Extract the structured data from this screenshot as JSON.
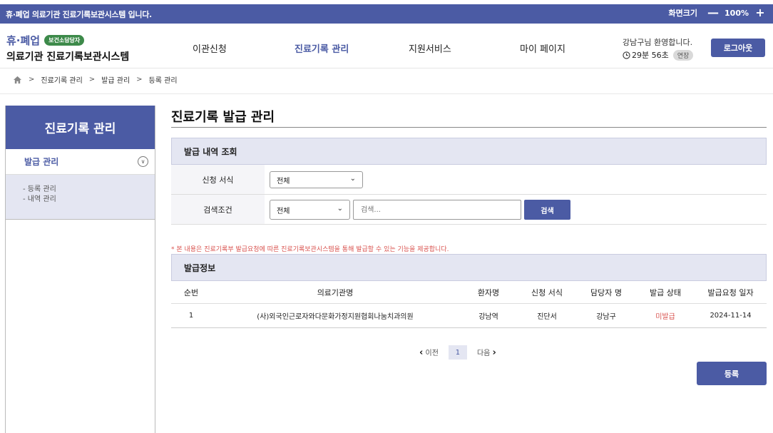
{
  "topbar": {
    "notice": "휴·폐업 의료기관 진료기록보관시스템 입니다.",
    "zoom_label": "화면크기",
    "zoom_minus": "—",
    "zoom_value": "100%",
    "zoom_plus": "+"
  },
  "brand": {
    "sub": "휴·폐업",
    "badge": "보건소담당자",
    "main": "의료기관 진료기록보관시스템"
  },
  "gnb": [
    "이관신청",
    "진료기록 관리",
    "지원서비스",
    "마이 페이지"
  ],
  "user": {
    "greeting": "강남구님 환영합니다.",
    "timer": "29분 56초",
    "extend": "연장",
    "logout": "로그아웃"
  },
  "breadcrumb": [
    "진료기록 관리",
    "발급 관리",
    "등록 관리"
  ],
  "sidebar": {
    "title": "진료기록 관리",
    "menu_label": "발급 관리",
    "sub_items": [
      "- 등록 관리",
      "- 내역 관리"
    ]
  },
  "page_title": "진료기록 발급 관리",
  "search_panel": {
    "title": "발급 내역 조회",
    "form_label": "신청 서식",
    "form_value": "전체",
    "cond_label": "검색조건",
    "cond_value": "전체",
    "search_placeholder": "검색...",
    "search_button": "검색"
  },
  "notice": "* 본 내용은 진료기록부 발급요청에 따른 진료기록보관시스템을 통해 발급할 수 있는 기능을 제공합니다.",
  "result_panel": {
    "title": "발급정보",
    "columns": [
      "순번",
      "의료기관명",
      "환자명",
      "신청 서식",
      "담당자 명",
      "발급 상태",
      "발급요청 일자"
    ],
    "rows": [
      [
        "1",
        "(사)외국인근로자와다문화가정지원협회나눔치과의원",
        "강남역",
        "진단서",
        "강남구",
        "미발급",
        "2024-11-14"
      ]
    ]
  },
  "pager": {
    "prev": "이전",
    "current": "1",
    "next": "다음"
  },
  "register_button": "등록",
  "colors": {
    "primary": "#4b5ba4",
    "accent_red": "#d9534f",
    "panel_bg": "#e4e6f2"
  }
}
